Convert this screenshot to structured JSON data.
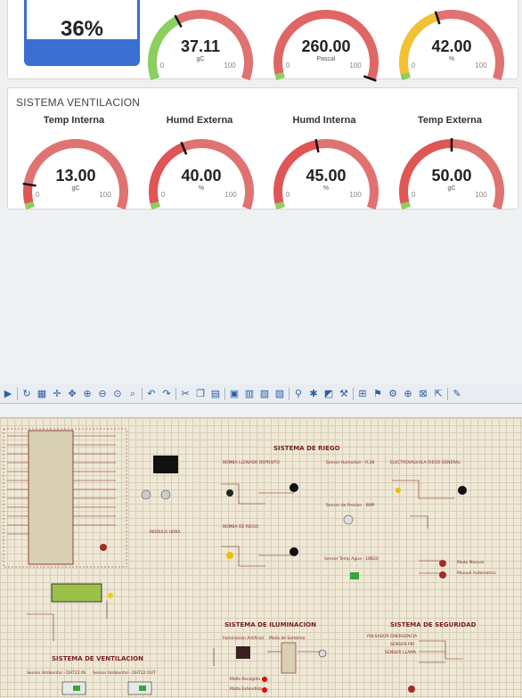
{
  "top_row": {
    "tank_level": {
      "value_text": "36%",
      "fill_fraction": 0.36
    },
    "gauges": [
      {
        "value": "37.11",
        "unit": "gC",
        "min": "0",
        "max": "100",
        "fraction": 0.3711,
        "color": "#8bcf5e"
      },
      {
        "value": "260.00",
        "unit": "Pascal",
        "min": "0",
        "max": "100",
        "fraction": 1.0,
        "color": "#e06666"
      },
      {
        "value": "42.00",
        "unit": "%",
        "min": "0",
        "max": "100",
        "fraction": 0.42,
        "color": "#f2c233"
      }
    ]
  },
  "ventilacion": {
    "title": "SISTEMA VENTILACION",
    "gauges": [
      {
        "label": "Temp Interna",
        "value": "13.00",
        "unit": "gC",
        "min": "0",
        "max": "100",
        "fraction": 0.13,
        "color": "#e05555"
      },
      {
        "label": "Humd Externa",
        "value": "40.00",
        "unit": "%",
        "min": "0",
        "max": "100",
        "fraction": 0.4,
        "color": "#e05555"
      },
      {
        "label": "Humd Interna",
        "value": "45.00",
        "unit": "%",
        "min": "0",
        "max": "100",
        "fraction": 0.45,
        "color": "#e05555"
      },
      {
        "label": "Temp Externa",
        "value": "50.00",
        "unit": "gC",
        "min": "0",
        "max": "100",
        "fraction": 0.5,
        "color": "#e05555"
      }
    ]
  },
  "schematic": {
    "section_titles": {
      "riego": "SISTEMA DE RIEGO",
      "iluminacion": "SISTEMA DE ILUMINACION",
      "seguridad": "SISTEMA DE SEGURIDAD",
      "ventilacion": "SISTEMA DE VENTILACION"
    },
    "labels": {
      "bomba_llenado": "BOMBA LLENADO DEPOSITO",
      "bomba_riego": "BOMBA DE RIEGO",
      "sensor_humedad": "Sensor Humedad - YL38",
      "sensor_presion": "Sensor de Presion - BMP",
      "sensor_temp_agua": "Sensor Temp Agua - 18B20",
      "electrovalvula": "ELECTROVALVULA RIEGO GENERAL",
      "modo_manual": "Modo Manual",
      "manual_automatico": "Manual Automatico",
      "modulo_hora": "MODULO HORA",
      "iluminacion_artificial": "Iluminacion Artificial",
      "malla_sombreo": "Malla de Sombreo",
      "malla_recogida": "Malla Recogida",
      "malla_extendida": "Malla Extendida",
      "pulsador_emergencia": "PULSADOR EMERGENCIA",
      "sensor_pir": "SENSOR PIR",
      "sensor_llama": "SENSOR LLAMA",
      "sensor_ambiental_in": "Sensor Ambiental - DHT22 IN",
      "sensor_ambiental_out": "Sensor Ambiental - DHT22 OUT"
    }
  }
}
